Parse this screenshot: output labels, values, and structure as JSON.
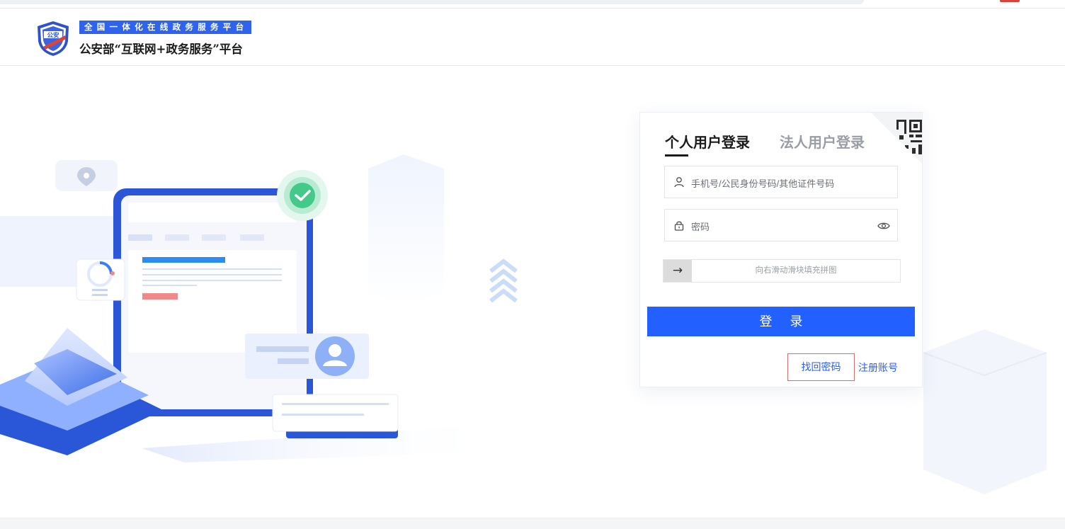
{
  "header": {
    "tagline": "全国一体化在线政务服务平台",
    "logo_text": "公安",
    "platform_name": "公安部“互联网+政务服务”平台"
  },
  "login": {
    "tabs": [
      {
        "label": "个人用户登录",
        "active": true
      },
      {
        "label": "法人用户登录",
        "active": false
      }
    ],
    "username_placeholder": "手机号/公民身份号码/其他证件号码",
    "password_placeholder": "密码",
    "slider_arrow": "→",
    "slider_hint": "向右滑动滑块填充拼图",
    "login_button": "登 录",
    "forgot_password": "找回密码",
    "register": "注册账号"
  },
  "colors": {
    "accent": "#2260ff",
    "brand_blue": "#2f63ee",
    "highlight_border": "#e0686a"
  },
  "icons": [
    "shield-logo-icon",
    "user-icon",
    "lock-icon",
    "eye-icon",
    "qr-code-icon"
  ]
}
